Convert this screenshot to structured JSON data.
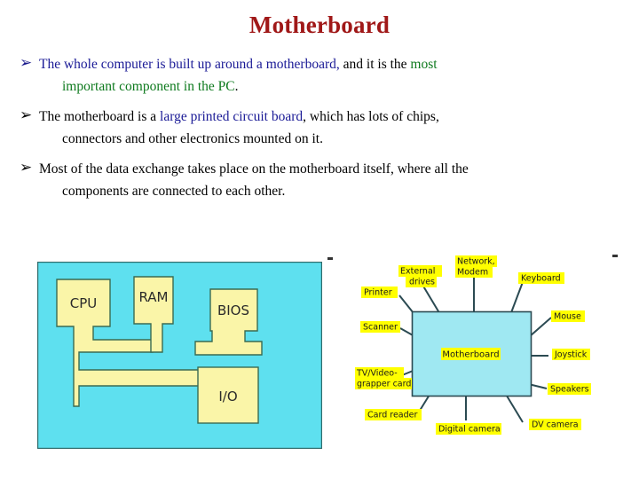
{
  "slide": {
    "title": "Motherboard"
  },
  "bullets": [
    {
      "marker": "➢",
      "marker_color": "navy",
      "segments_line1": [
        {
          "text": "The whole computer is built up around a motherboard,",
          "color": "blue"
        },
        {
          "text": " and it is the ",
          "color": "black"
        },
        {
          "text": "most",
          "color": "green"
        }
      ],
      "segments_line2": [
        {
          "text": "important component in the PC",
          "color": "green"
        },
        {
          "text": ".",
          "color": "black"
        }
      ]
    },
    {
      "marker": "➢",
      "marker_color": "black",
      "segments_line1": [
        {
          "text": "The motherboard is a ",
          "color": "black"
        },
        {
          "text": "large printed circuit board",
          "color": "blue"
        },
        {
          "text": ", which has lots of chips,",
          "color": "black"
        }
      ],
      "segments_line2": [
        {
          "text": "connectors and other electronics mounted on it.",
          "color": "black"
        }
      ]
    },
    {
      "marker": "➢",
      "marker_color": "black",
      "segments_line1": [
        {
          "text": "Most of the data exchange takes place on the motherboard itself, where all the",
          "color": "black"
        }
      ],
      "segments_line2": [
        {
          "text": "components are connected to each other.",
          "color": "black"
        }
      ]
    }
  ],
  "figure_left": {
    "name": "motherboard-block-diagram",
    "board_color": "#5ee0ef",
    "trace_color": "#faf5a8",
    "outline_color": "#2f6b6b",
    "blocks": [
      {
        "id": "cpu",
        "label": "CPU"
      },
      {
        "id": "ram",
        "label": "RAM"
      },
      {
        "id": "bios",
        "label": "BIOS"
      },
      {
        "id": "io",
        "label": "I/O"
      }
    ]
  },
  "figure_right": {
    "name": "motherboard-peripherals-diagram",
    "board_color": "#9fe8f2",
    "board_label": "Motherboard",
    "highlight_color": "#ffff00",
    "line_color": "#2b4a52",
    "labels": [
      {
        "id": "printer",
        "text": "Printer"
      },
      {
        "id": "external-drives",
        "text": "External\ndrives",
        "lines": [
          "External",
          "drives"
        ]
      },
      {
        "id": "network-modem",
        "text": "Network,\nModem",
        "lines": [
          "Network,",
          "Modem"
        ]
      },
      {
        "id": "keyboard",
        "text": "Keyboard"
      },
      {
        "id": "mouse",
        "text": "Mouse"
      },
      {
        "id": "scanner",
        "text": "Scanner"
      },
      {
        "id": "joystick",
        "text": "Joystick"
      },
      {
        "id": "tv-video-card",
        "text": "TV/Video-\ngrapper card",
        "lines": [
          "TV/Video-",
          "grapper card"
        ]
      },
      {
        "id": "speakers",
        "text": "Speakers"
      },
      {
        "id": "card-reader",
        "text": "Card reader"
      },
      {
        "id": "digital-camera",
        "text": "Digital camera"
      },
      {
        "id": "dv-camera",
        "text": "DV camera"
      }
    ]
  }
}
